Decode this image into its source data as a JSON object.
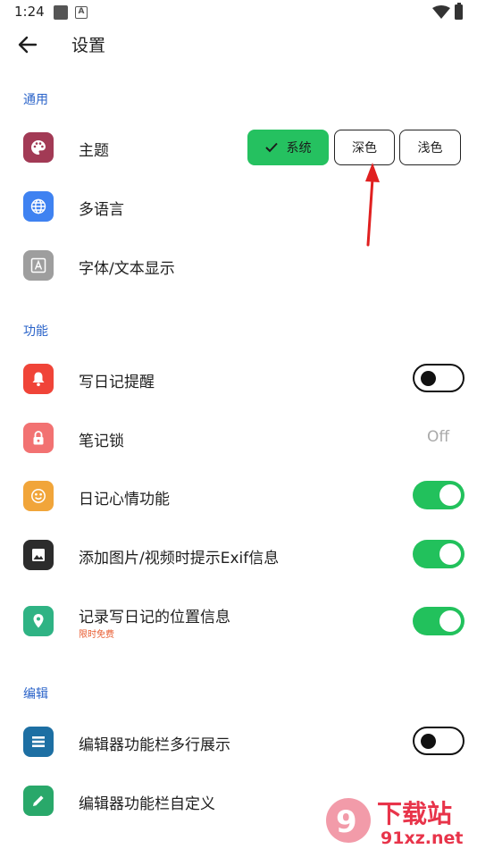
{
  "status_bar": {
    "time": "1:24"
  },
  "header": {
    "title": "设置"
  },
  "sections": {
    "general": "通用",
    "features": "功能",
    "editor": "编辑"
  },
  "theme": {
    "label": "主题",
    "options": [
      "系统",
      "深色",
      "浅色"
    ],
    "selected": "系统"
  },
  "general_items": [
    {
      "label": "多语言"
    },
    {
      "label": "字体/文本显示"
    }
  ],
  "feature_items": [
    {
      "label": "写日记提醒",
      "toggle": false
    },
    {
      "label": "笔记锁",
      "value": "Off"
    },
    {
      "label": "日记心情功能",
      "toggle": true
    },
    {
      "label": "添加图片/视频时提示Exif信息",
      "toggle": true
    },
    {
      "label": "记录写日记的位置信息",
      "sublabel": "限时免费",
      "toggle": true
    }
  ],
  "editor_items": [
    {
      "label": "编辑器功能栏多行展示",
      "toggle": false
    },
    {
      "label": "编辑器功能栏自定义"
    }
  ],
  "watermark": {
    "brand": "下载站",
    "url": "91xz.net"
  },
  "colors": {
    "accent_blue": "#2a63c9",
    "toggle_on": "#22c15c",
    "selected_segment": "#25c160",
    "theme_icon": "#a23a55",
    "language_icon": "#3f82f1",
    "font_icon": "#9e9e9e",
    "reminder_icon": "#f04438",
    "lock_icon": "#f27272",
    "mood_icon": "#f1a53a",
    "exif_icon": "#2c2c2c",
    "location_icon": "#2fb384",
    "multiline_icon": "#1d6fa3",
    "custom_icon": "#29a86a",
    "annotation": "#e02020"
  }
}
